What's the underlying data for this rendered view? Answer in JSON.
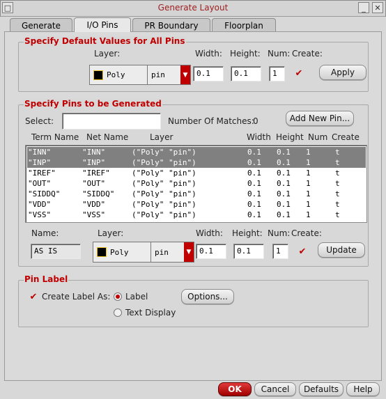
{
  "window": {
    "title": "Generate Layout"
  },
  "tabs": [
    {
      "label": "Generate"
    },
    {
      "label": "I/O Pins"
    },
    {
      "label": "PR Boundary"
    },
    {
      "label": "Floorplan"
    }
  ],
  "defaults_group": {
    "title": "Specify Default Values for All Pins",
    "layer_label": "Layer:",
    "width_label": "Width:",
    "height_label": "Height:",
    "num_label": "Num:",
    "create_label": "Create:",
    "layer_value": "Poly",
    "purpose_value": "pin",
    "width_value": "0.1",
    "height_value": "0.1",
    "num_value": "1",
    "create_checked": "✔",
    "apply_label": "Apply"
  },
  "pins_group": {
    "title": "Specify Pins to be Generated",
    "select_label": "Select:",
    "select_value": "",
    "matches_label": "Number Of Matches:",
    "matches_value": "0",
    "add_new_pin_label": "Add New Pin...",
    "columns": [
      "Term Name",
      "Net Name",
      "Layer",
      "Width",
      "Height",
      "Num",
      "Create"
    ],
    "rows": [
      {
        "term": "\"INN\"",
        "net": "\"INN\"",
        "layer": "(\"Poly\" \"pin\")",
        "width": "0.1",
        "height": "0.1",
        "num": "1",
        "create": "t",
        "selected": true
      },
      {
        "term": "\"INP\"",
        "net": "\"INP\"",
        "layer": "(\"Poly\" \"pin\")",
        "width": "0.1",
        "height": "0.1",
        "num": "1",
        "create": "t",
        "selected": true
      },
      {
        "term": "\"IREF\"",
        "net": "\"IREF\"",
        "layer": "(\"Poly\" \"pin\")",
        "width": "0.1",
        "height": "0.1",
        "num": "1",
        "create": "t",
        "selected": false
      },
      {
        "term": "\"OUT\"",
        "net": "\"OUT\"",
        "layer": "(\"Poly\" \"pin\")",
        "width": "0.1",
        "height": "0.1",
        "num": "1",
        "create": "t",
        "selected": false
      },
      {
        "term": "\"SIDDQ\"",
        "net": "\"SIDDQ\"",
        "layer": "(\"Poly\" \"pin\")",
        "width": "0.1",
        "height": "0.1",
        "num": "1",
        "create": "t",
        "selected": false
      },
      {
        "term": "\"VDD\"",
        "net": "\"VDD\"",
        "layer": "(\"Poly\" \"pin\")",
        "width": "0.1",
        "height": "0.1",
        "num": "1",
        "create": "t",
        "selected": false
      },
      {
        "term": "\"VSS\"",
        "net": "\"VSS\"",
        "layer": "(\"Poly\" \"pin\")",
        "width": "0.1",
        "height": "0.1",
        "num": "1",
        "create": "t",
        "selected": false
      }
    ],
    "name_label": "Name:",
    "name_value": "AS IS",
    "layer_label": "Layer:",
    "layer_value": "Poly",
    "purpose_value": "pin",
    "width_label": "Width:",
    "width_value": "0.1",
    "height_label": "Height:",
    "height_value": "0.1",
    "num_label": "Num:",
    "num_value": "1",
    "create_label": "Create:",
    "create_checked": "✔",
    "update_label": "Update"
  },
  "pin_label_group": {
    "title": "Pin Label",
    "create_label_as": "Create Label As:",
    "create_checked": "✔",
    "option_label": "Label",
    "option_text_display": "Text Display",
    "options_button": "Options..."
  },
  "bottom_buttons": {
    "ok": "OK",
    "cancel": "Cancel",
    "defaults": "Defaults",
    "help": "Help"
  },
  "icons": {
    "minimize": "minimize-icon",
    "close": "close-icon",
    "dropdown": "chevron-down-icon",
    "checkmark": "checkmark-icon"
  },
  "colors": {
    "accent": "#c00000",
    "selected_row": "#808080"
  }
}
